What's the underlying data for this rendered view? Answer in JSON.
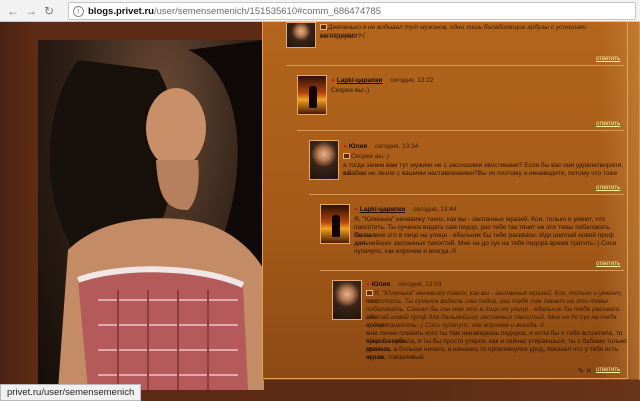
{
  "browser": {
    "url_domain": "blogs.privet.ru",
    "url_path": "/user/semensemenich/151535610#comm_686474785",
    "status_url": "privet.ru/user/semensemenich"
  },
  "comments": [
    {
      "text_line1": "Джеченько я не водывал тут мужиков, одни лишь балаболящие арбузы с усохшими хвостиками :-(",
      "text_line2": "вы педераст?",
      "reply_label": "ответить"
    },
    {
      "user": "Lapki-царапки",
      "time": "сегодня, 13:22",
      "text": "Скорее вы:-)",
      "reply_label": "ответить"
    },
    {
      "user": "Юлия",
      "time": "сегодня, 13:34",
      "quote": "Скорее вы:-)",
      "text_line1": "а тогда зачем вам тут мужики не с засохшими хвостиками? Если бы вас они удовлетворяли, вы",
      "text_line2": "к бабам не лезли с вашими наставлениями?Вы их поэтому и ненавидите, потому что тоже",
      "reply_label": "ответить"
    },
    {
      "user": "Lapki-царапки",
      "time": "сегодня, 13:44",
      "lines": [
        "Я, \"Юленька\" ненавижу таких, как вы - заспанных мразей. Кои, только и умеют, что",
        "пакостить. Ты сученок видать сам пидор, раз тебя так тянет на эти темы побалакать. Сказал",
        "бы ты мне это в лицо на улице - ебальник бы тебе раскваси. Иди шелпай новой проф для",
        "дальнейших заспанных пакостий. Мне на до сук на тебя пидора время тратить:-) Соси",
        "чупачупс, как впрочем и всегда.-0"
      ],
      "reply_label": "ответить"
    },
    {
      "user": "Юлия",
      "time": "сегодня, 13:53",
      "quoted_lines": [
        "Я, \"Юленька\" ненавижу таких, как вы - заспанных мразей. Кои, только и умеют, что",
        "пакостить. Ты сученок видать сам пидор, раз тебя так тянет на эти темы",
        "побалакать. Сказал бы ты мне это в лицо на улице - ебальник бы тебе раскваси. Иди",
        "шелпай новой проф для дальнейших заспанных пакостий. Мне не до сук на тебя пидора",
        "время тратить:-) Соси чупачупс, как впрочем и всегда.-0"
      ],
      "lines": [
        "мне лично плевать кого ты там ненавидишь пидорок, и если бы я тебя встретила, то яйца бы тебе",
        "хуесос вырвала, и ты бы просто утерся, как и сейчас утираешься, ты с бабами только можешь",
        "драться, а больше ничего, и наконец то проклюнулся урод, показал что у тебя есть пушка, говорливый",
        "херов"
      ],
      "reply_label": "ответить"
    }
  ]
}
